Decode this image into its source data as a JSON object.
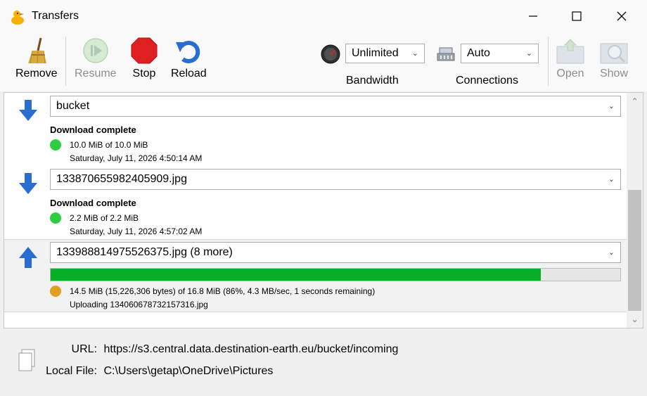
{
  "window": {
    "title": "Transfers"
  },
  "toolbar": {
    "remove": "Remove",
    "resume": "Resume",
    "stop": "Stop",
    "reload": "Reload",
    "bandwidth": {
      "value": "Unlimited",
      "label": "Bandwidth"
    },
    "connections": {
      "value": "Auto",
      "label": "Connections"
    },
    "open": "Open",
    "show": "Show"
  },
  "transfers": [
    {
      "direction": "download",
      "name": "bucket",
      "status": "Download complete",
      "status_color": "#2ecc40",
      "size_text": "10.0 MiB of 10.0 MiB",
      "time_text": "Saturday, July 11, 2026 4:50:14 AM"
    },
    {
      "direction": "download",
      "name": "133870655982405909.jpg",
      "status": "Download complete",
      "status_color": "#2ecc40",
      "size_text": "2.2 MiB of 2.2 MiB",
      "time_text": "Saturday, July 11, 2026 4:57:02 AM"
    },
    {
      "direction": "upload",
      "name": "133988814975526375.jpg (8 more)",
      "progress": 0.86,
      "status_color": "#e0a020",
      "size_text": "14.5 MiB (15,226,306 bytes) of 16.8 MiB (86%, 4.3 MB/sec, 1 seconds remaining)",
      "time_text": "Uploading 134060678732157316.jpg"
    }
  ],
  "details": {
    "url_label": "URL:",
    "url": "https://s3.central.data.destination-earth.eu/bucket/incoming",
    "local_label": "Local File:",
    "local": "C:\\Users\\getap\\OneDrive\\Pictures"
  },
  "colors": {
    "accent": "#2a6dd0",
    "progress": "#06b025",
    "stop": "#e02020"
  }
}
